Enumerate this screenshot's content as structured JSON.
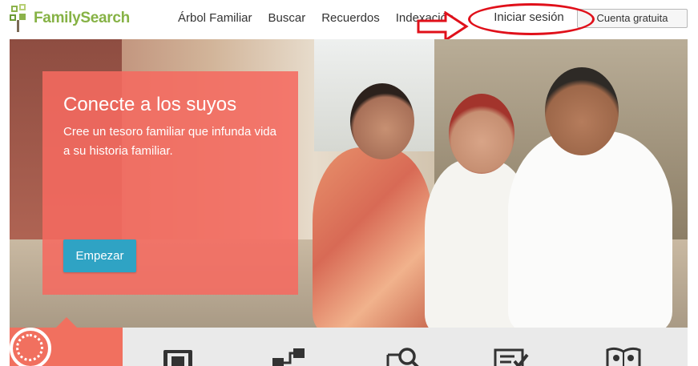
{
  "header": {
    "logo_text": "FamilySearch",
    "nav": [
      "Árbol Familiar",
      "Buscar",
      "Recuerdos",
      "Indexación"
    ],
    "signin_label": "Iniciar sesión",
    "signup_label": "Cuenta gratuita"
  },
  "hero": {
    "title": "Conecte a los suyos",
    "text": "Cree un tesoro familiar que infunda vida a su historia familiar.",
    "cta_label": "Empezar",
    "panel_color": "#f56a60",
    "button_color": "#2fa3c4"
  },
  "annotation": {
    "color": "#e0101a",
    "shapes": [
      "arrow-right",
      "ellipse"
    ]
  },
  "tools": [
    {
      "icon": "compass-icon",
      "active": true
    },
    {
      "icon": "photo-book-icon",
      "active": false
    },
    {
      "icon": "family-tree-icon",
      "active": false
    },
    {
      "icon": "search-magnifier-icon",
      "active": false
    },
    {
      "icon": "indexing-checklist-icon",
      "active": false
    },
    {
      "icon": "people-book-icon",
      "active": false
    }
  ]
}
